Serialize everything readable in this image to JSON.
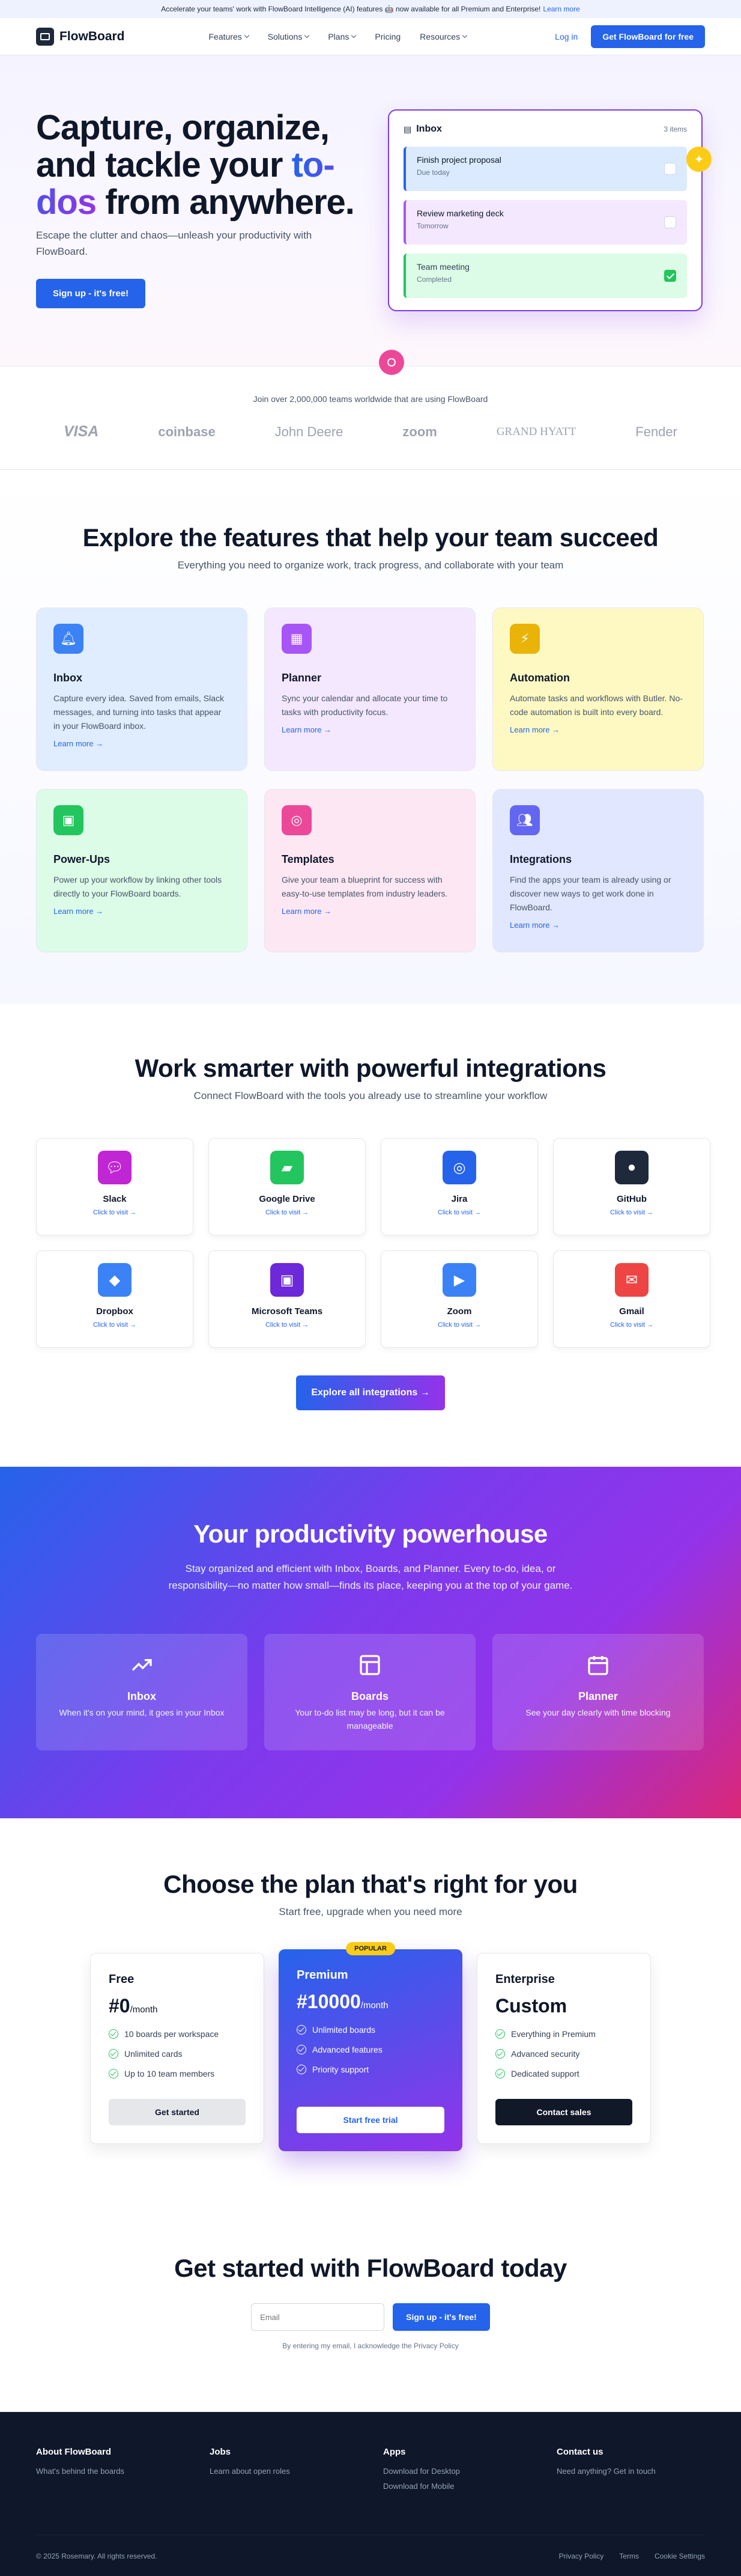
{
  "announcement": {
    "text": "Accelerate your teams' work with FlowBoard Intelligence (AI) features 🤖 now available for all Premium and Enterprise!",
    "link": "Learn more"
  },
  "nav": {
    "brand": "FlowBoard",
    "items": [
      "Features",
      "Solutions",
      "Plans",
      "Pricing",
      "Resources"
    ],
    "login": "Log in",
    "cta": "Get FlowBoard for free"
  },
  "hero": {
    "title_part1": "Capture, organize, and tackle your ",
    "title_highlight": "to-dos",
    "title_part2": " from anywhere.",
    "subtitle": "Escape the clutter and chaos—unleash your productivity with FlowBoard.",
    "cta": "Sign up - it's free!",
    "inbox": {
      "title": "Inbox",
      "count": "3 items",
      "tasks": [
        {
          "title": "Finish project proposal",
          "due": "Due today"
        },
        {
          "title": "Review marketing deck",
          "due": "Tomorrow"
        },
        {
          "title": "Team meeting",
          "due": "Completed"
        }
      ]
    }
  },
  "trust": {
    "text": "Join over 2,000,000 teams worldwide that are using FlowBoard",
    "logos": [
      "VISA",
      "coinbase",
      "John Deere",
      "zoom",
      "GRAND HYATT",
      "Fender"
    ]
  },
  "features": {
    "title": "Explore the features that help your team succeed",
    "subtitle": "Everything you need to organize work, track progress, and collaborate with your team",
    "learn_more": "Learn more →",
    "cards": [
      {
        "title": "Inbox",
        "text": "Capture every idea. Saved from emails, Slack messages, and turning into tasks that appear in your FlowBoard inbox.",
        "icon": "bell-icon",
        "bg": "#e0ecff",
        "color": "#3b82f6"
      },
      {
        "title": "Planner",
        "text": "Sync your calendar and allocate your time to tasks with productivity focus.",
        "icon": "calendar-icon",
        "bg": "#f3e8ff",
        "color": "#a855f7"
      },
      {
        "title": "Automation",
        "text": "Automate tasks and workflows with Butler. No-code automation is built into every board.",
        "icon": "lightning-icon",
        "bg": "#fef9c3",
        "color": "#eab308"
      },
      {
        "title": "Power-Ups",
        "text": "Power up your workflow by linking other tools directly to your FlowBoard boards.",
        "icon": "puzzle-icon",
        "bg": "#dcfce7",
        "color": "#22c55e"
      },
      {
        "title": "Templates",
        "text": "Give your team a blueprint for success with easy-to-use templates from industry leaders.",
        "icon": "template-icon",
        "bg": "#fce7f3",
        "color": "#ec4899"
      },
      {
        "title": "Integrations",
        "text": "Find the apps your team is already using or discover new ways to get work done in FlowBoard.",
        "icon": "users-icon",
        "bg": "#e0e7ff",
        "color": "#6366f1"
      }
    ]
  },
  "integrations": {
    "title": "Work smarter with powerful integrations",
    "subtitle": "Connect FlowBoard with the tools you already use to streamline your workflow",
    "visit": "Click to visit →",
    "button": "Explore all integrations →",
    "apps": [
      {
        "name": "Slack",
        "color": "#c026d3",
        "icon": "chat-bubble-icon"
      },
      {
        "name": "Google Drive",
        "color": "#22c55e",
        "icon": "folder-icon"
      },
      {
        "name": "Jira",
        "color": "#2563eb",
        "icon": "target-icon"
      },
      {
        "name": "GitHub",
        "color": "#1e293b",
        "icon": "octocat-icon"
      },
      {
        "name": "Dropbox",
        "color": "#3b82f6",
        "icon": "box-icon"
      },
      {
        "name": "Microsoft Teams",
        "color": "#6d28d9",
        "icon": "team-icon"
      },
      {
        "name": "Zoom",
        "color": "#3b82f6",
        "icon": "video-icon"
      },
      {
        "name": "Gmail",
        "color": "#ef4444",
        "icon": "mail-icon"
      }
    ]
  },
  "power": {
    "title": "Your productivity powerhouse",
    "text": "Stay organized and efficient with Inbox, Boards, and Planner. Every to-do, idea, or responsibility—no matter how small—finds its place, keeping you at the top of your game.",
    "cards": [
      {
        "title": "Inbox",
        "text": "When it's on your mind, it goes in your Inbox",
        "icon": "trend-up-icon"
      },
      {
        "title": "Boards",
        "text": "Your to-do list may be long, but it can be manageable",
        "icon": "board-icon"
      },
      {
        "title": "Planner",
        "text": "See your day clearly with time blocking",
        "icon": "calendar-icon"
      }
    ]
  },
  "plans": {
    "title": "Choose the plan that's right for you",
    "subtitle": "Start free, upgrade when you need more",
    "free": {
      "name": "Free",
      "price": "#0",
      "period": "/month",
      "features": [
        "10 boards per workspace",
        "Unlimited cards",
        "Up to 10 team members"
      ],
      "button": "Get started"
    },
    "premium": {
      "badge": "POPULAR",
      "name": "Premium",
      "price": "#10000",
      "period": "/month",
      "features": [
        "Unlimited boards",
        "Advanced features",
        "Priority support"
      ],
      "button": "Start free trial"
    },
    "enterprise": {
      "name": "Enterprise",
      "price": "Custom",
      "features": [
        "Everything in Premium",
        "Advanced security",
        "Dedicated support"
      ],
      "button": "Contact sales"
    }
  },
  "getstarted": {
    "title": "Get started with FlowBoard today",
    "placeholder": "Email",
    "button": "Sign up - it's free!",
    "note": "By entering my email, I acknowledge the Privacy Policy"
  },
  "footer": {
    "cols": [
      {
        "title": "About FlowBoard",
        "links": [
          "What's behind the boards"
        ]
      },
      {
        "title": "Jobs",
        "links": [
          "Learn about open roles"
        ]
      },
      {
        "title": "Apps",
        "links": [
          "Download for Desktop",
          "Download for Mobile"
        ]
      },
      {
        "title": "Contact us",
        "links": [
          "Need anything? Get in touch"
        ]
      }
    ],
    "copyright": "© 2025 Rosemary. All rights reserved.",
    "legal": [
      "Privacy Policy",
      "Terms",
      "Cookie Settings"
    ]
  }
}
